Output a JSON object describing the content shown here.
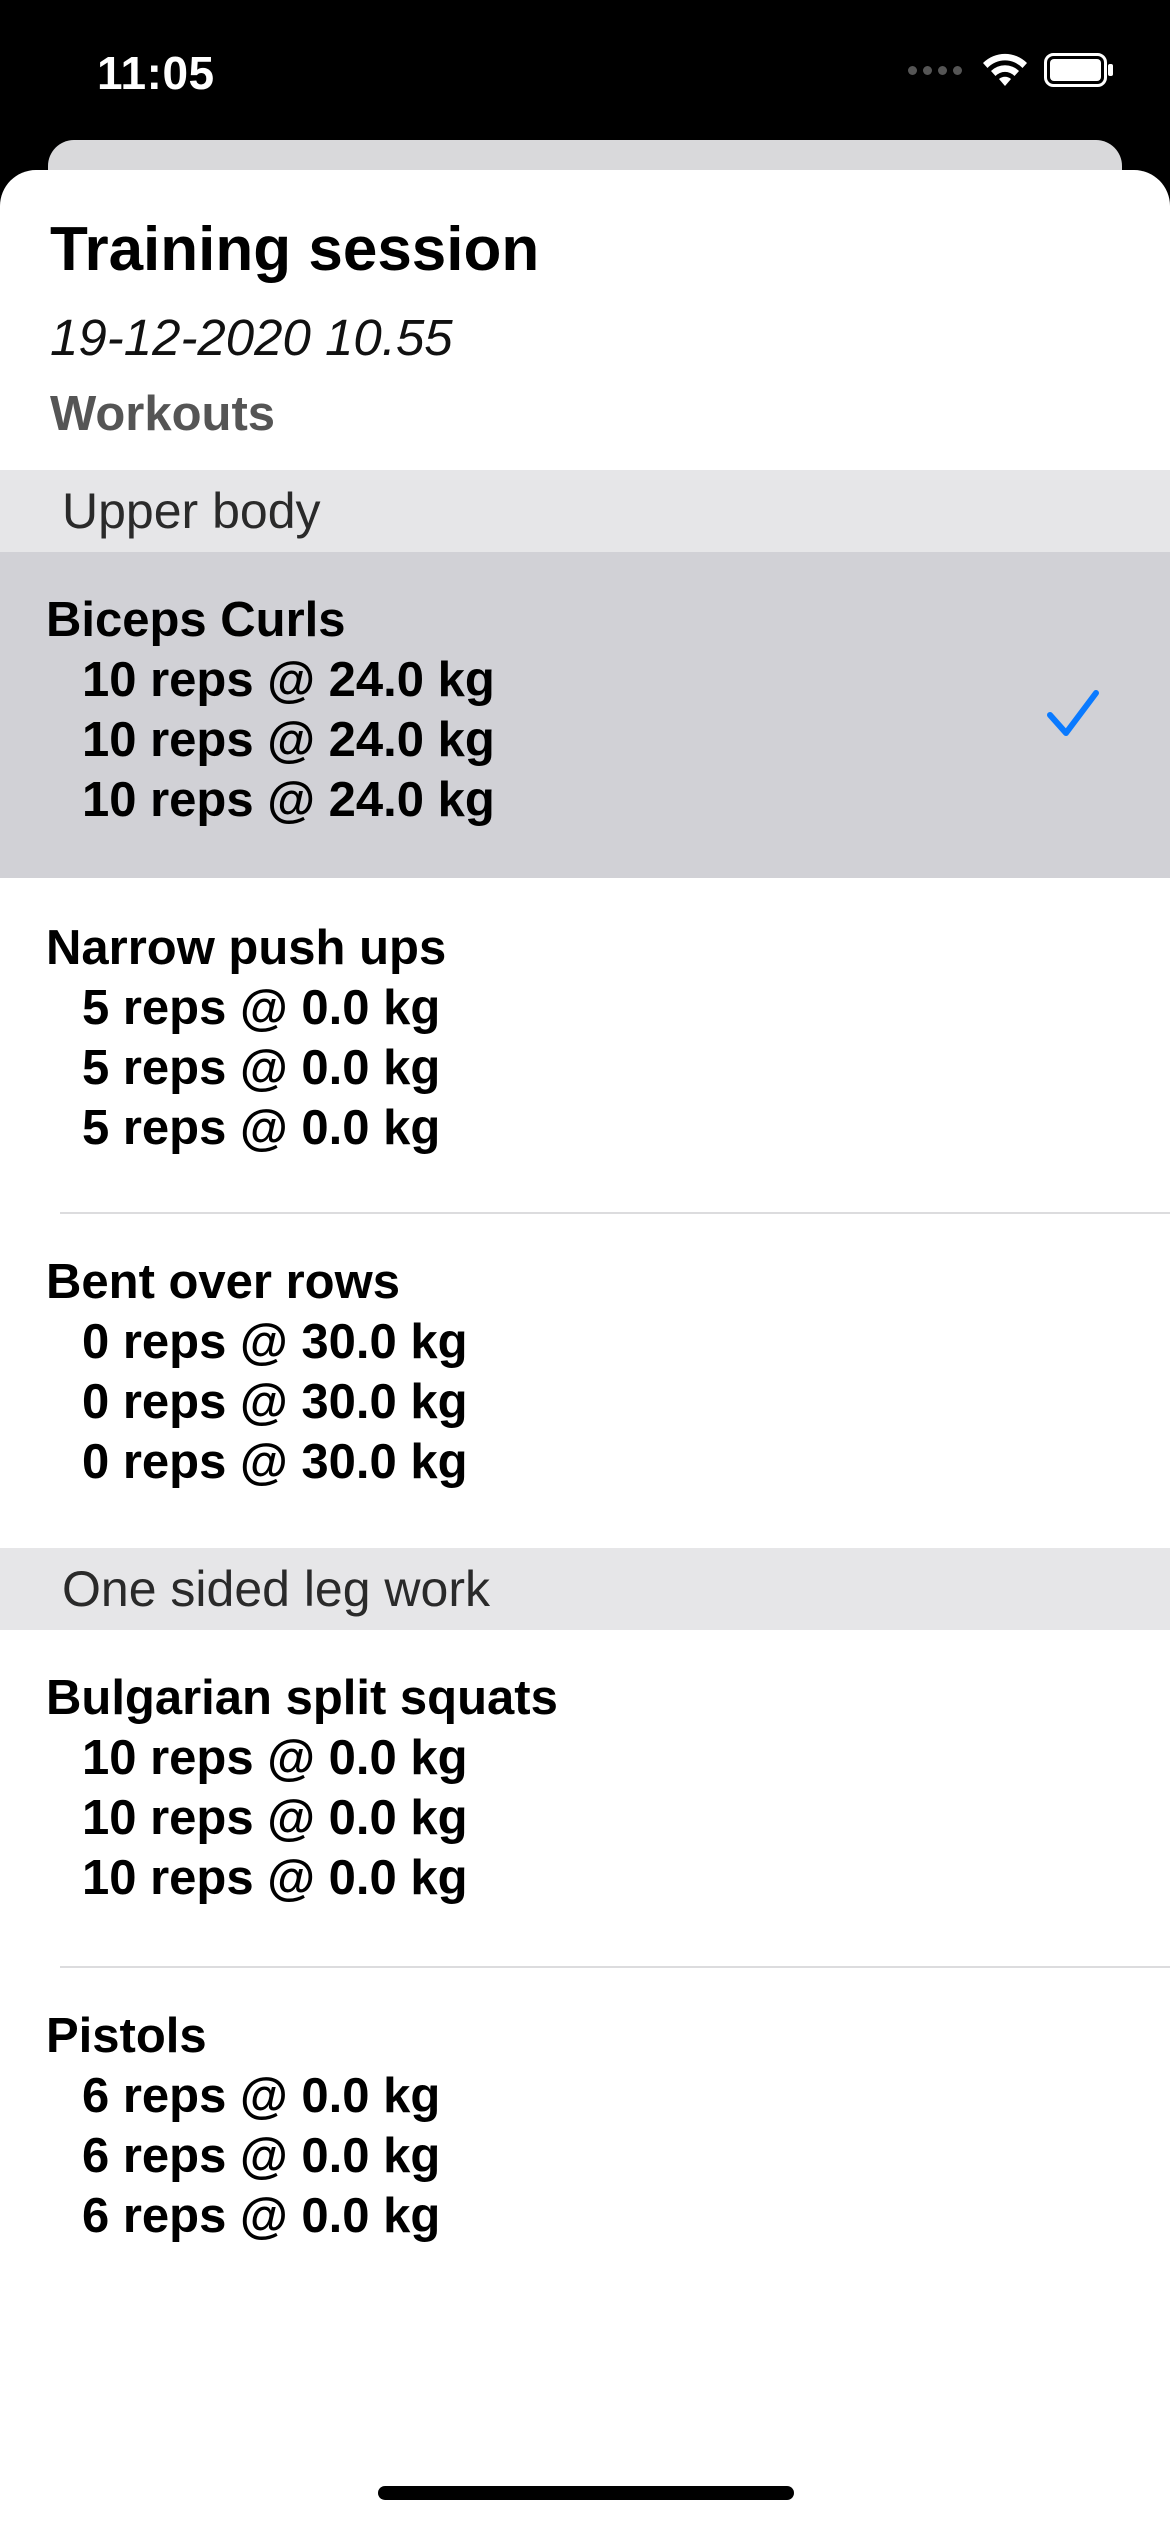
{
  "status_bar": {
    "time": "11:05",
    "icons": [
      "signal-dots-icon",
      "wifi-icon",
      "battery-icon"
    ]
  },
  "sheet": {
    "title": "Training session",
    "date": "19-12-2020 10.55",
    "subtitle": "Workouts"
  },
  "colors": {
    "accent": "#0a7aff",
    "selected_row": "#d1d1d6",
    "section_header": "#e6e6e8"
  },
  "sections": [
    {
      "header": "Upper body",
      "exercises": [
        {
          "name": "Biceps Curls",
          "sets": [
            "10 reps @ 24.0 kg",
            "10 reps @ 24.0 kg",
            "10 reps @ 24.0 kg"
          ],
          "selected": true
        },
        {
          "name": "Narrow push ups",
          "sets": [
            "5 reps @ 0.0 kg",
            "5 reps @ 0.0 kg",
            "5 reps @ 0.0 kg"
          ]
        },
        {
          "name": "Bent over rows",
          "sets": [
            "0 reps @ 30.0 kg",
            "0 reps @ 30.0 kg",
            "0 reps @ 30.0 kg"
          ]
        }
      ]
    },
    {
      "header": "One sided leg work",
      "exercises": [
        {
          "name": "Bulgarian split squats",
          "sets": [
            "10 reps @ 0.0 kg",
            "10 reps @ 0.0 kg",
            "10 reps @ 0.0 kg"
          ]
        },
        {
          "name": "Pistols",
          "sets": [
            "6 reps @ 0.0 kg",
            "6 reps @ 0.0 kg",
            "6 reps @ 0.0 kg"
          ]
        }
      ]
    }
  ]
}
